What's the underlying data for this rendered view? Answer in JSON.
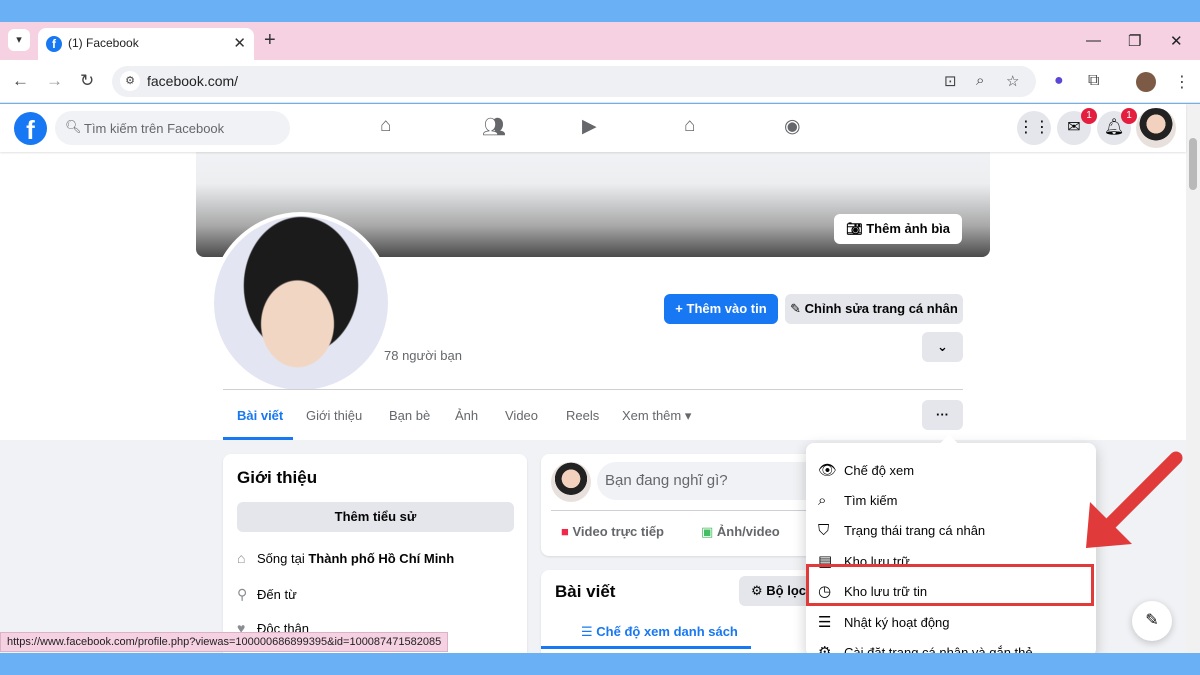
{
  "browser": {
    "tab_title": "(1) Facebook",
    "url": "facebook.com/",
    "status_url": "https://www.facebook.com/profile.php?viewas=100000686899395&id=100087471582085"
  },
  "header": {
    "search_placeholder": "Tìm kiếm trên Facebook",
    "messenger_badge": "1",
    "notif_badge": "1"
  },
  "profile": {
    "cover_button": "Thêm ảnh bìa",
    "friends_count": "78 người bạn",
    "add_story": "Thêm vào tin",
    "edit_profile": "Chỉnh sửa trang cá nhân",
    "tabs": [
      "Bài viết",
      "Giới thiệu",
      "Bạn bè",
      "Ảnh",
      "Video",
      "Reels",
      "Xem thêm"
    ]
  },
  "intro": {
    "title": "Giới thiệu",
    "add_bio": "Thêm tiểu sử",
    "lives_prefix": "Sống tại",
    "lives_city": "Thành phố Hồ Chí Minh",
    "from": "Đến từ",
    "relationship": "Độc thân"
  },
  "composer": {
    "placeholder": "Bạn đang nghĩ gì?",
    "live_video": "Video trực tiếp",
    "photo_video": "Ảnh/video"
  },
  "posts": {
    "title": "Bài viết",
    "filter": "Bộ lọc",
    "list_view": "Chế độ xem danh sách"
  },
  "menu": {
    "items": [
      "Chế độ xem",
      "Tìm kiếm",
      "Trạng thái trang cá nhân",
      "Kho lưu trữ",
      "Kho lưu trữ tin",
      "Nhật ký hoạt động",
      "Cài đặt trang cá nhân và gắn thẻ"
    ],
    "highlighted_index": 4
  },
  "colors": {
    "fb_blue": "#1877f2",
    "highlight_red": "#e03a3a",
    "tab_strip": "#f5d1e2"
  }
}
